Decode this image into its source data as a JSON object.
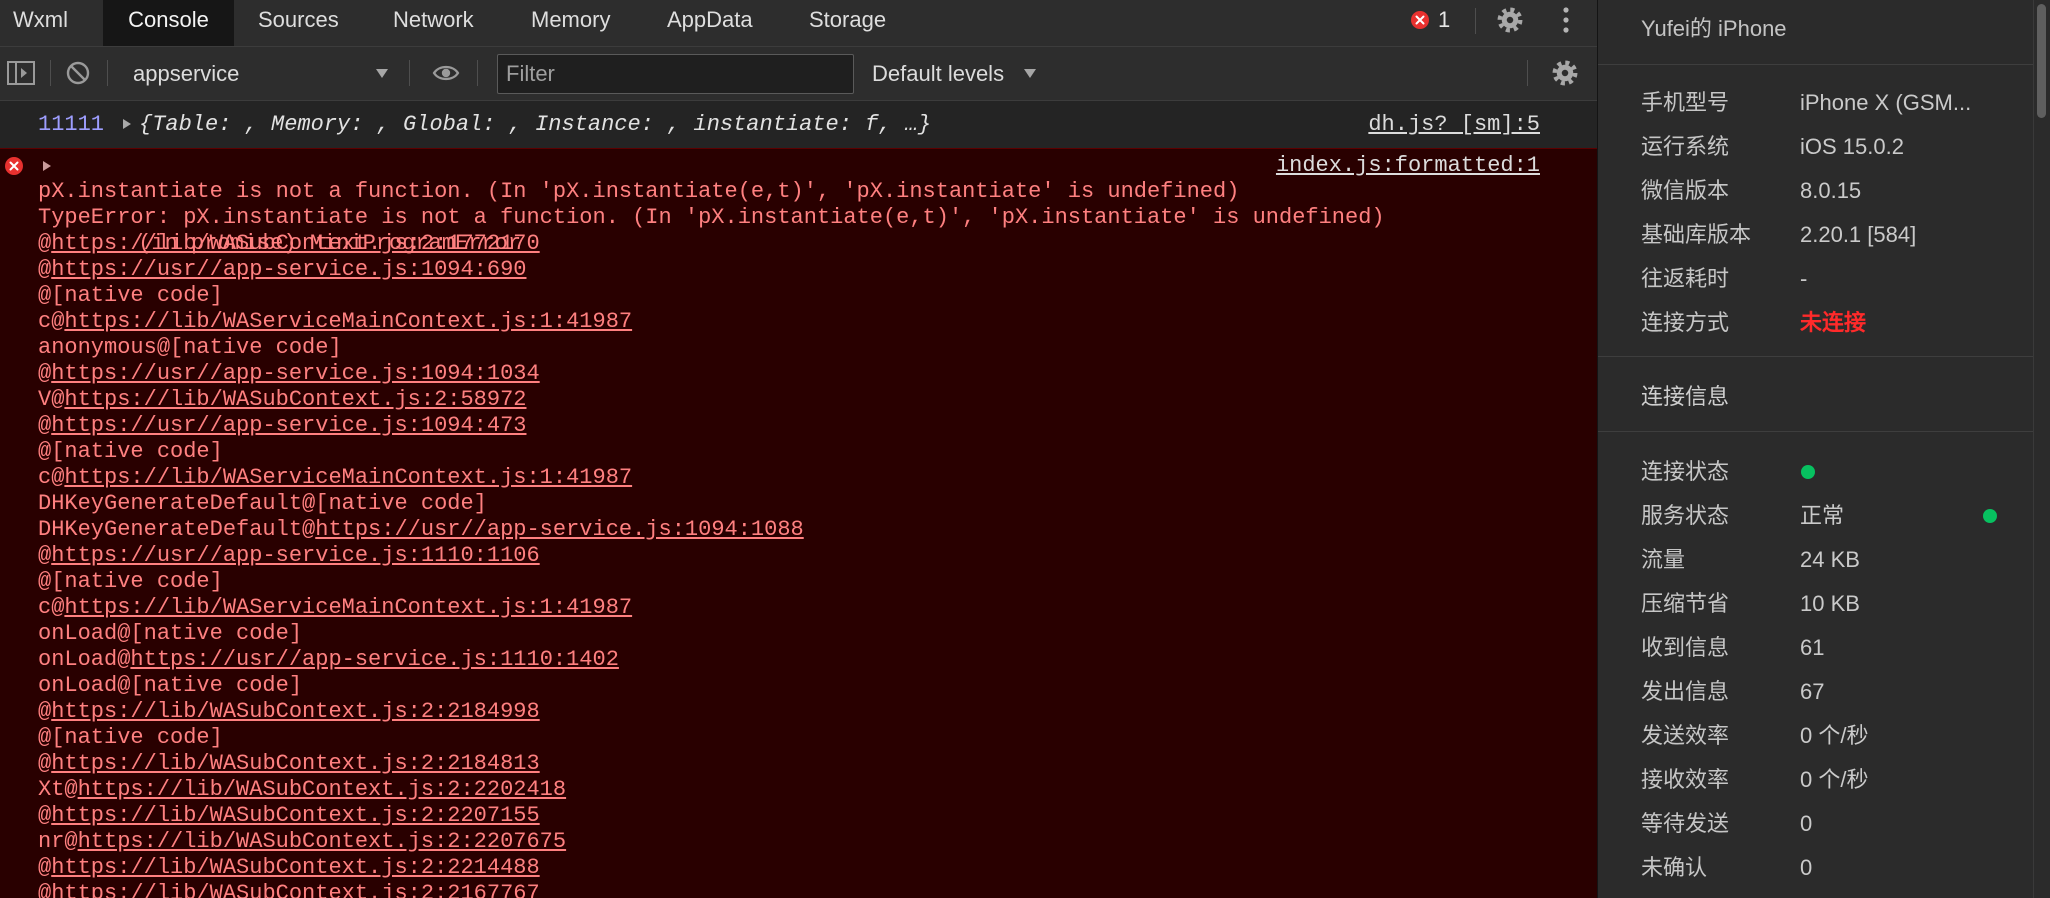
{
  "theme": {
    "error_text": "#ff8080",
    "error_background": "#290000",
    "number_color": "#9e9eff",
    "disconnected_color": "#ff2a2a",
    "status_ok_color": "#07c160"
  },
  "tabs": [
    {
      "label": "Wxml"
    },
    {
      "label": "Console",
      "active": true
    },
    {
      "label": "Sources"
    },
    {
      "label": "Network"
    },
    {
      "label": "Memory"
    },
    {
      "label": "AppData"
    },
    {
      "label": "Storage"
    }
  ],
  "tab_bar": {
    "error_count": "1",
    "icons": [
      "error-icon",
      "settings-icon",
      "more-icon"
    ]
  },
  "toolbar": {
    "context": "appservice",
    "filter_placeholder": "Filter",
    "levels": "Default levels",
    "icons": [
      "sidebar-toggle-icon",
      "clear-console-icon",
      "eye-icon",
      "settings-icon"
    ]
  },
  "console": {
    "log": {
      "value": "11111",
      "object_preview": "{Table: , Memory: , Global: , Instance: , instantiate: f, …}",
      "source": "dh.js? [sm]:5"
    },
    "error": {
      "summary": "(in promise) MiniProgramError",
      "source": "index.js:formatted:1",
      "message": "pX.instantiate is not a function. (In 'pX.instantiate(e,t)', 'pX.instantiate' is undefined)",
      "type_message": "TypeError: pX.instantiate is not a function. (In 'pX.instantiate(e,t)', 'pX.instantiate' is undefined)",
      "stack": [
        {
          "text": "@",
          "url": "https://lib/WASubContext.js:2:1772170"
        },
        {
          "text": "@",
          "url": "https://usr//app-service.js:1094:690"
        },
        {
          "text": "@[native code]"
        },
        {
          "text": "c@",
          "url": "https://lib/WAServiceMainContext.js:1:41987"
        },
        {
          "text": "anonymous@[native code]"
        },
        {
          "text": "@",
          "url": "https://usr//app-service.js:1094:1034"
        },
        {
          "text": "V@",
          "url": "https://lib/WASubContext.js:2:58972"
        },
        {
          "text": "@",
          "url": "https://usr//app-service.js:1094:473"
        },
        {
          "text": "@[native code]"
        },
        {
          "text": "c@",
          "url": "https://lib/WAServiceMainContext.js:1:41987"
        },
        {
          "text": "DHKeyGenerateDefault@[native code]"
        },
        {
          "text": "DHKeyGenerateDefault@",
          "url": "https://usr//app-service.js:1094:1088"
        },
        {
          "text": "@",
          "url": "https://usr//app-service.js:1110:1106"
        },
        {
          "text": "@[native code]"
        },
        {
          "text": "c@",
          "url": "https://lib/WAServiceMainContext.js:1:41987"
        },
        {
          "text": "onLoad@[native code]"
        },
        {
          "text": "onLoad@",
          "url": "https://usr//app-service.js:1110:1402"
        },
        {
          "text": "onLoad@[native code]"
        },
        {
          "text": "@",
          "url": "https://lib/WASubContext.js:2:2184998"
        },
        {
          "text": "@[native code]"
        },
        {
          "text": "@",
          "url": "https://lib/WASubContext.js:2:2184813"
        },
        {
          "text": "Xt@",
          "url": "https://lib/WASubContext.js:2:2202418"
        },
        {
          "text": "@",
          "url": "https://lib/WASubContext.js:2:2207155"
        },
        {
          "text": "nr@",
          "url": "https://lib/WASubContext.js:2:2207675"
        },
        {
          "text": "@",
          "url": "https://lib/WASubContext.js:2:2214488"
        },
        {
          "text": "@",
          "url": "https://lib/WASubContext.js:2:2167767"
        }
      ]
    }
  },
  "device": {
    "name": "Yufei的 iPhone",
    "info": [
      {
        "label": "手机型号",
        "value": "iPhone X (GSM..."
      },
      {
        "label": "运行系统",
        "value": "iOS 15.0.2"
      },
      {
        "label": "微信版本",
        "value": "8.0.15"
      },
      {
        "label": "基础库版本",
        "value": "2.20.1 [584]"
      },
      {
        "label": "往返耗时",
        "value": "-"
      },
      {
        "label": "连接方式",
        "value": "未连接"
      }
    ],
    "connection_heading": "连接信息",
    "connection": [
      {
        "label": "连接状态"
      },
      {
        "label": "服务状态",
        "value": "正常"
      },
      {
        "label": "流量",
        "value": "24 KB"
      },
      {
        "label": "压缩节省",
        "value": "10 KB"
      },
      {
        "label": "收到信息",
        "value": "61"
      },
      {
        "label": "发出信息",
        "value": "67"
      },
      {
        "label": "发送效率",
        "value": "0 个/秒"
      },
      {
        "label": "接收效率",
        "value": "0 个/秒"
      },
      {
        "label": "等待发送",
        "value": "0"
      },
      {
        "label": "未确认",
        "value": "0"
      }
    ]
  }
}
